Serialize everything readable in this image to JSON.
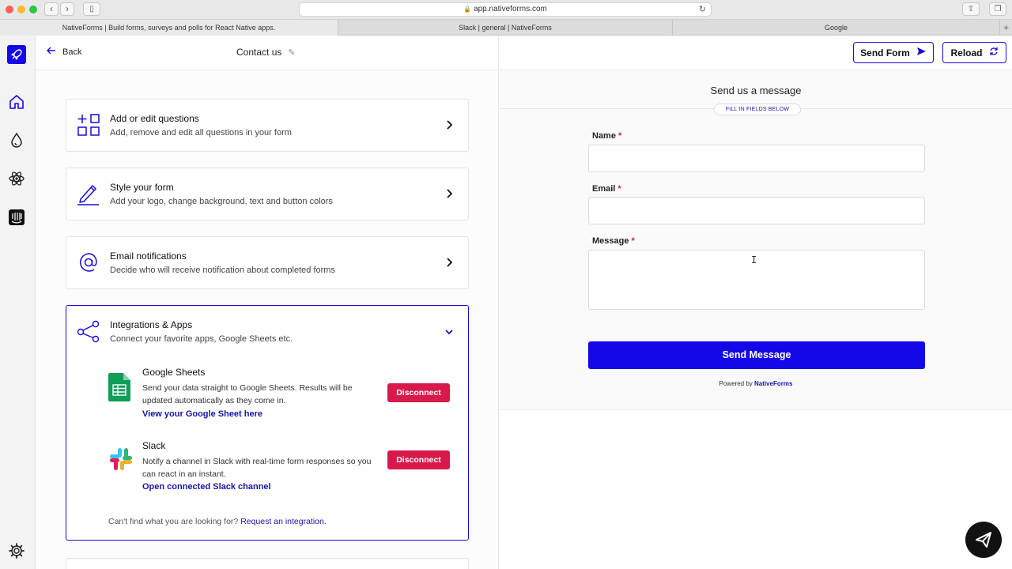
{
  "browser": {
    "url": "app.nativeforms.com",
    "tabs": [
      {
        "label": "NativeForms | Build forms, surveys and polls for React Native apps.",
        "active": true
      },
      {
        "label": "Slack | general | NativeForms",
        "active": false
      },
      {
        "label": "Google",
        "active": false
      }
    ],
    "new_tab": "+"
  },
  "rail": {
    "icons": [
      "rocket-logo-icon",
      "home-icon",
      "drop-icon",
      "react-icon",
      "intercom-icon",
      "gear-icon"
    ]
  },
  "editor": {
    "back_label": "Back",
    "form_title": "Contact us",
    "cards": [
      {
        "icon": "grid-plus-icon",
        "title": "Add or edit questions",
        "subtitle": "Add, remove and edit all questions in your form"
      },
      {
        "icon": "pencil-icon",
        "title": "Style your form",
        "subtitle": "Add your logo, change background, text and button colors"
      },
      {
        "icon": "at-sign-icon",
        "title": "Email notifications",
        "subtitle": "Decide who will receive notification about completed forms"
      }
    ],
    "integrations": {
      "icon": "share-icon",
      "title": "Integrations & Apps",
      "subtitle": "Connect your favorite apps, Google Sheets etc.",
      "apps": [
        {
          "name": "Google Sheets",
          "description": "Send your data straight to Google Sheets. Results will be updated automatically as they come in.",
          "link": "View your Google Sheet here",
          "action": "Disconnect"
        },
        {
          "name": "Slack",
          "description": "Notify a channel in Slack with real-time form responses so you can react in an instant.",
          "link": "Open connected Slack channel",
          "action": "Disconnect"
        }
      ],
      "footer_text": "Can't find what you are looking for?",
      "footer_link": "Request an integration."
    }
  },
  "preview": {
    "send_form_label": "Send Form",
    "reload_label": "Reload",
    "form_heading": "Send us a message",
    "badge": "FILL IN FIELDS BELOW",
    "fields": [
      {
        "label": "Name",
        "required_mark": "*"
      },
      {
        "label": "Email",
        "required_mark": "*"
      },
      {
        "label": "Message",
        "required_mark": "*"
      }
    ],
    "submit_label": "Send Message",
    "powered_prefix": "Powered by",
    "powered_brand": "NativeForms"
  },
  "colors": {
    "accent": "#1508e8",
    "danger": "#d7194b",
    "link": "#1a14a8"
  }
}
